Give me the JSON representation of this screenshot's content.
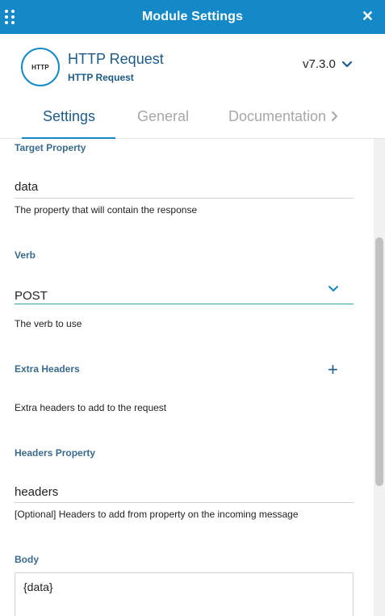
{
  "window": {
    "title": "Module Settings",
    "close_glyph": "✕"
  },
  "module": {
    "logo_text": "HTTP",
    "title": "HTTP Request",
    "subtitle": "HTTP Request",
    "version": "v7.3.0"
  },
  "tabs": [
    {
      "label": "Settings",
      "active": true
    },
    {
      "label": "General",
      "active": false
    },
    {
      "label": "Documentation",
      "active": false
    }
  ],
  "fields": {
    "target_property": {
      "label": "Target Property",
      "value": "data",
      "description": "The property that will contain the response"
    },
    "verb": {
      "label": "Verb",
      "value": "POST",
      "description": "The verb to use"
    },
    "extra_headers": {
      "label": "Extra Headers",
      "add_glyph": "+",
      "description": "Extra headers to add to the request"
    },
    "headers_property": {
      "label": "Headers Property",
      "value": "headers",
      "description": "[Optional] Headers to add from property on the incoming message"
    },
    "body": {
      "label": "Body",
      "value": "{data}"
    }
  },
  "colors": {
    "titlebar": "#1589c8",
    "accent_text": "#1d5a86",
    "label_text": "#3a6b8c",
    "inactive_tab": "#a7a7a7",
    "verb_underline": "#3aa3a0"
  },
  "icons": {
    "grip": "grip-dots-icon",
    "close": "close-icon",
    "version_dropdown": "chevron-down-icon",
    "tabs_next": "chevron-right-icon",
    "verb_dropdown": "chevron-down-icon",
    "add": "plus-icon"
  }
}
